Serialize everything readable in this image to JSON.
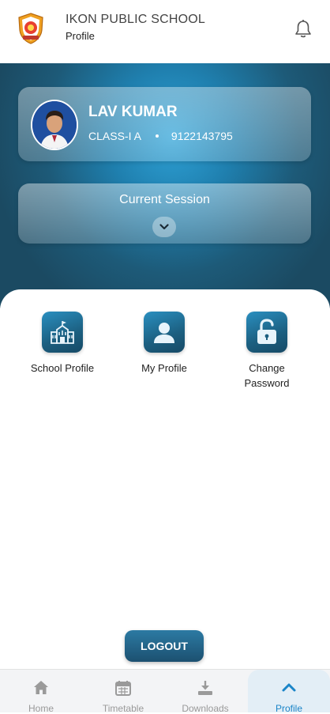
{
  "header": {
    "school_name": "IKON PUBLIC SCHOOL",
    "page_title": "Profile"
  },
  "student": {
    "name": "LAV KUMAR",
    "class": "CLASS-I A",
    "phone": "9122143795"
  },
  "session": {
    "label": "Current Session"
  },
  "tiles": [
    {
      "label": "School Profile",
      "icon": "school-building-icon"
    },
    {
      "label": "My Profile",
      "icon": "user-icon"
    },
    {
      "label": "Change Password",
      "icon": "unlock-icon"
    }
  ],
  "logout_label": "LOGOUT",
  "nav": [
    {
      "label": "Home",
      "icon": "home-icon"
    },
    {
      "label": "Timetable",
      "icon": "calendar-icon"
    },
    {
      "label": "Downloads",
      "icon": "download-icon"
    },
    {
      "label": "Profile",
      "icon": "chevron-up-icon",
      "active": true
    }
  ],
  "colors": {
    "accent": "#1b85c8",
    "hero_dark": "#1b4a62",
    "hero_light": "#2fa3d8"
  }
}
